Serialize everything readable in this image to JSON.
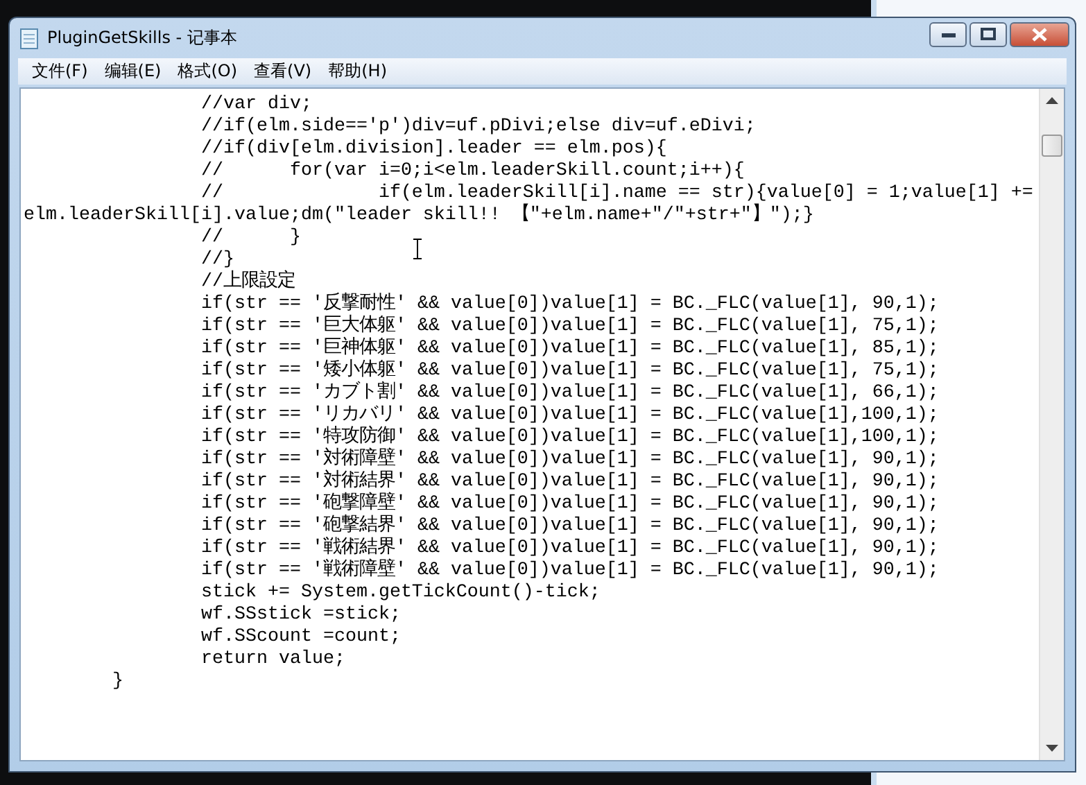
{
  "window": {
    "title": "PluginGetSkills - 记事本"
  },
  "menu": [
    {
      "label": "文件(F)"
    },
    {
      "label": "编辑(E)"
    },
    {
      "label": "格式(O)"
    },
    {
      "label": "查看(V)"
    },
    {
      "label": "帮助(H)"
    }
  ],
  "editor": {
    "lines": [
      "                //var div;",
      "                //if(elm.side=='p')div=uf.pDivi;else div=uf.eDivi;",
      "                //if(div[elm.division].leader == elm.pos){",
      "                //      for(var i=0;i<elm.leaderSkill.count;i++){",
      "                //              if(elm.leaderSkill[i].name == str){value[0] = 1;value[1] +=",
      "elm.leaderSkill[i].value;dm(\"leader skill!! 【\"+elm.name+\"/\"+str+\"】\");}",
      "                //      }",
      "                //}",
      "                //上限設定",
      "                if(str == '反撃耐性' && value[0])value[1] = BC._FLC(value[1], 90,1);",
      "                if(str == '巨大体躯' && value[0])value[1] = BC._FLC(value[1], 75,1);",
      "                if(str == '巨神体躯' && value[0])value[1] = BC._FLC(value[1], 85,1);",
      "                if(str == '矮小体躯' && value[0])value[1] = BC._FLC(value[1], 75,1);",
      "                if(str == 'カブト割' && value[0])value[1] = BC._FLC(value[1], 66,1);",
      "                if(str == 'リカバリ' && value[0])value[1] = BC._FLC(value[1],100,1);",
      "                if(str == '特攻防御' && value[0])value[1] = BC._FLC(value[1],100,1);",
      "                if(str == '対術障壁' && value[0])value[1] = BC._FLC(value[1], 90,1);",
      "                if(str == '対術結界' && value[0])value[1] = BC._FLC(value[1], 90,1);",
      "                if(str == '砲撃障壁' && value[0])value[1] = BC._FLC(value[1], 90,1);",
      "                if(str == '砲撃結界' && value[0])value[1] = BC._FLC(value[1], 90,1);",
      "                if(str == '戦術結界' && value[0])value[1] = BC._FLC(value[1], 90,1);",
      "                if(str == '戦術障壁' && value[0])value[1] = BC._FLC(value[1], 90,1);",
      "                stick += System.getTickCount()-tick;",
      "                wf.SSstick =stick;",
      "                wf.SScount =count;",
      "                return value;",
      "        }"
    ]
  }
}
